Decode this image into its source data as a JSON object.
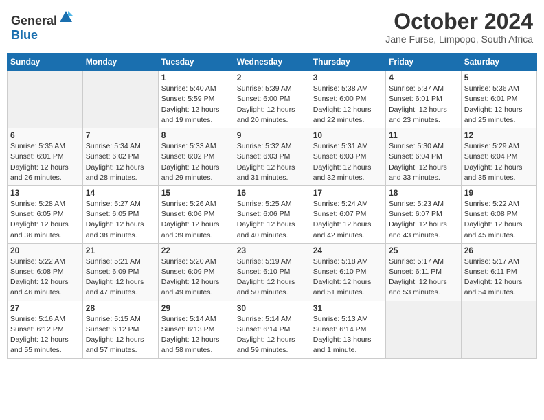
{
  "header": {
    "logo_general": "General",
    "logo_blue": "Blue",
    "month": "October 2024",
    "location": "Jane Furse, Limpopo, South Africa"
  },
  "weekdays": [
    "Sunday",
    "Monday",
    "Tuesday",
    "Wednesday",
    "Thursday",
    "Friday",
    "Saturday"
  ],
  "weeks": [
    [
      {
        "day": null
      },
      {
        "day": null
      },
      {
        "day": "1",
        "sunrise": "5:40 AM",
        "sunset": "5:59 PM",
        "daylight": "12 hours and 19 minutes."
      },
      {
        "day": "2",
        "sunrise": "5:39 AM",
        "sunset": "6:00 PM",
        "daylight": "12 hours and 20 minutes."
      },
      {
        "day": "3",
        "sunrise": "5:38 AM",
        "sunset": "6:00 PM",
        "daylight": "12 hours and 22 minutes."
      },
      {
        "day": "4",
        "sunrise": "5:37 AM",
        "sunset": "6:01 PM",
        "daylight": "12 hours and 23 minutes."
      },
      {
        "day": "5",
        "sunrise": "5:36 AM",
        "sunset": "6:01 PM",
        "daylight": "12 hours and 25 minutes."
      }
    ],
    [
      {
        "day": "6",
        "sunrise": "5:35 AM",
        "sunset": "6:01 PM",
        "daylight": "12 hours and 26 minutes."
      },
      {
        "day": "7",
        "sunrise": "5:34 AM",
        "sunset": "6:02 PM",
        "daylight": "12 hours and 28 minutes."
      },
      {
        "day": "8",
        "sunrise": "5:33 AM",
        "sunset": "6:02 PM",
        "daylight": "12 hours and 29 minutes."
      },
      {
        "day": "9",
        "sunrise": "5:32 AM",
        "sunset": "6:03 PM",
        "daylight": "12 hours and 31 minutes."
      },
      {
        "day": "10",
        "sunrise": "5:31 AM",
        "sunset": "6:03 PM",
        "daylight": "12 hours and 32 minutes."
      },
      {
        "day": "11",
        "sunrise": "5:30 AM",
        "sunset": "6:04 PM",
        "daylight": "12 hours and 33 minutes."
      },
      {
        "day": "12",
        "sunrise": "5:29 AM",
        "sunset": "6:04 PM",
        "daylight": "12 hours and 35 minutes."
      }
    ],
    [
      {
        "day": "13",
        "sunrise": "5:28 AM",
        "sunset": "6:05 PM",
        "daylight": "12 hours and 36 minutes."
      },
      {
        "day": "14",
        "sunrise": "5:27 AM",
        "sunset": "6:05 PM",
        "daylight": "12 hours and 38 minutes."
      },
      {
        "day": "15",
        "sunrise": "5:26 AM",
        "sunset": "6:06 PM",
        "daylight": "12 hours and 39 minutes."
      },
      {
        "day": "16",
        "sunrise": "5:25 AM",
        "sunset": "6:06 PM",
        "daylight": "12 hours and 40 minutes."
      },
      {
        "day": "17",
        "sunrise": "5:24 AM",
        "sunset": "6:07 PM",
        "daylight": "12 hours and 42 minutes."
      },
      {
        "day": "18",
        "sunrise": "5:23 AM",
        "sunset": "6:07 PM",
        "daylight": "12 hours and 43 minutes."
      },
      {
        "day": "19",
        "sunrise": "5:22 AM",
        "sunset": "6:08 PM",
        "daylight": "12 hours and 45 minutes."
      }
    ],
    [
      {
        "day": "20",
        "sunrise": "5:22 AM",
        "sunset": "6:08 PM",
        "daylight": "12 hours and 46 minutes."
      },
      {
        "day": "21",
        "sunrise": "5:21 AM",
        "sunset": "6:09 PM",
        "daylight": "12 hours and 47 minutes."
      },
      {
        "day": "22",
        "sunrise": "5:20 AM",
        "sunset": "6:09 PM",
        "daylight": "12 hours and 49 minutes."
      },
      {
        "day": "23",
        "sunrise": "5:19 AM",
        "sunset": "6:10 PM",
        "daylight": "12 hours and 50 minutes."
      },
      {
        "day": "24",
        "sunrise": "5:18 AM",
        "sunset": "6:10 PM",
        "daylight": "12 hours and 51 minutes."
      },
      {
        "day": "25",
        "sunrise": "5:17 AM",
        "sunset": "6:11 PM",
        "daylight": "12 hours and 53 minutes."
      },
      {
        "day": "26",
        "sunrise": "5:17 AM",
        "sunset": "6:11 PM",
        "daylight": "12 hours and 54 minutes."
      }
    ],
    [
      {
        "day": "27",
        "sunrise": "5:16 AM",
        "sunset": "6:12 PM",
        "daylight": "12 hours and 55 minutes."
      },
      {
        "day": "28",
        "sunrise": "5:15 AM",
        "sunset": "6:12 PM",
        "daylight": "12 hours and 57 minutes."
      },
      {
        "day": "29",
        "sunrise": "5:14 AM",
        "sunset": "6:13 PM",
        "daylight": "12 hours and 58 minutes."
      },
      {
        "day": "30",
        "sunrise": "5:14 AM",
        "sunset": "6:14 PM",
        "daylight": "12 hours and 59 minutes."
      },
      {
        "day": "31",
        "sunrise": "5:13 AM",
        "sunset": "6:14 PM",
        "daylight": "13 hours and 1 minute."
      },
      {
        "day": null
      },
      {
        "day": null
      }
    ]
  ],
  "labels": {
    "sunrise": "Sunrise: ",
    "sunset": "Sunset: ",
    "daylight": "Daylight: "
  }
}
